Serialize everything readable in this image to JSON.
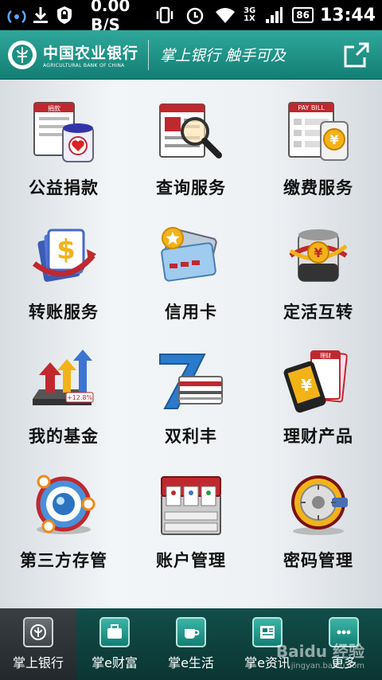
{
  "status_bar": {
    "speed": "0.00 B/S",
    "network": "3G",
    "network_sub": "1X",
    "battery": "86",
    "time": "13:44"
  },
  "header": {
    "bank_name_cn": "中国农业银行",
    "bank_name_en": "AGRICULTURAL BANK OF CHINA",
    "slogan": "掌上银行 触手可及"
  },
  "tiles": [
    {
      "label": "公益捐款",
      "icon": "donation-icon"
    },
    {
      "label": "查询服务",
      "icon": "query-icon"
    },
    {
      "label": "缴费服务",
      "icon": "pay-bill-icon"
    },
    {
      "label": "转账服务",
      "icon": "transfer-icon"
    },
    {
      "label": "信用卡",
      "icon": "credit-card-icon"
    },
    {
      "label": "定活互转",
      "icon": "deposit-swap-icon"
    },
    {
      "label": "我的基金",
      "icon": "fund-icon"
    },
    {
      "label": "双利丰",
      "icon": "shuanglifeng-icon"
    },
    {
      "label": "理财产品",
      "icon": "wealth-product-icon"
    },
    {
      "label": "第三方存管",
      "icon": "third-party-icon"
    },
    {
      "label": "账户管理",
      "icon": "account-icon"
    },
    {
      "label": "密码管理",
      "icon": "password-icon"
    }
  ],
  "icon_text": {
    "donation": "捐款",
    "pay_bill": "PAY BILL",
    "fund_pct": "+12.8%",
    "wealth": "理财"
  },
  "tabs": [
    {
      "label": "掌上银行",
      "active": true
    },
    {
      "label": "掌e财富",
      "active": false
    },
    {
      "label": "掌e生活",
      "active": false
    },
    {
      "label": "掌e资讯",
      "active": false
    },
    {
      "label": "更多",
      "active": false
    }
  ],
  "watermark": "Baidu 经验",
  "watermark_sub": "jingyan.baidu.com",
  "colors": {
    "header": "#1d9184",
    "tab_bar": "#0f423e",
    "accent": "#2fa89b"
  }
}
